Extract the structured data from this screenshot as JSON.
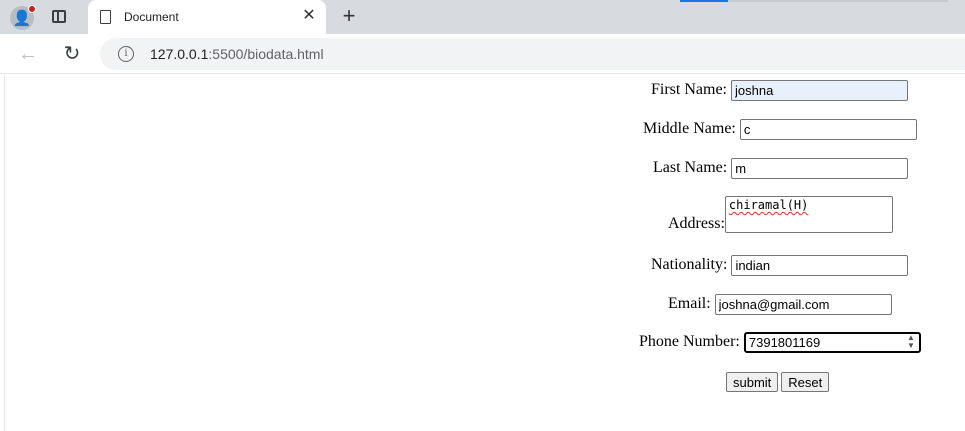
{
  "browser": {
    "tab": {
      "title": "Document"
    },
    "address": {
      "host": "127.0.0.1",
      "rest": ":5500/biodata.html"
    }
  },
  "form": {
    "first_name": {
      "label": "First Name:",
      "value": "joshna"
    },
    "middle_name": {
      "label": "Middle Name:",
      "value": "c"
    },
    "last_name": {
      "label": "Last Name:",
      "value": "m"
    },
    "address": {
      "label": "Address:",
      "value": "chiramal(H)"
    },
    "nationality": {
      "label": "Nationality:",
      "value": "indian"
    },
    "email": {
      "label": "Email:",
      "value": "joshna@gmail.com"
    },
    "phone": {
      "label": "Phone Number:",
      "value": "7391801169"
    },
    "submit_label": "submit",
    "reset_label": "Reset"
  }
}
